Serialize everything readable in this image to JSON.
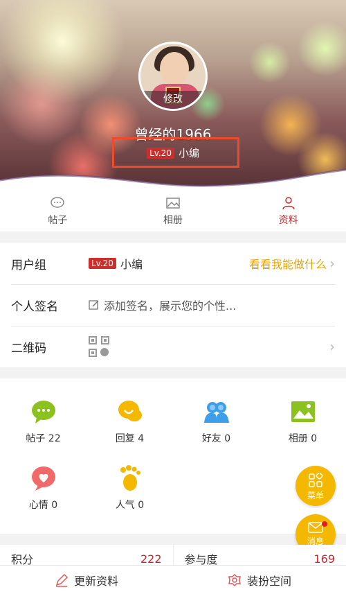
{
  "profile": {
    "username": "曾经的1966",
    "edit_label": "修改",
    "level_badge": "Lv.20",
    "level_title": "小编"
  },
  "tabs": [
    {
      "label": "帖子",
      "icon": "chat-bubble-icon",
      "active": false
    },
    {
      "label": "相册",
      "icon": "picture-icon",
      "active": false
    },
    {
      "label": "资料",
      "icon": "user-icon",
      "active": true
    }
  ],
  "info": {
    "user_group": {
      "label": "用户组",
      "badge": "Lv.20",
      "value": "小编",
      "action": "看看我能做什么"
    },
    "signature": {
      "label": "个人签名",
      "placeholder": "添加签名，展示您的个性..."
    },
    "qrcode": {
      "label": "二维码"
    }
  },
  "grid": [
    {
      "label": "帖子 22",
      "icon": "message-icon",
      "color": "#8cc21f"
    },
    {
      "label": "回复 4",
      "icon": "reply-icon",
      "color": "#f5b800"
    },
    {
      "label": "好友 0",
      "icon": "friends-icon",
      "color": "#3c9fe8"
    },
    {
      "label": "相册 0",
      "icon": "album-icon",
      "color": "#8cc21f"
    },
    {
      "label": "心情 0",
      "icon": "mood-heart-icon",
      "color": "#f06a6a"
    },
    {
      "label": "人气 0",
      "icon": "footprint-icon",
      "color": "#f5b800"
    }
  ],
  "fabs": {
    "menu_label": "菜单",
    "message_label": "消息"
  },
  "stats": [
    {
      "label": "积分",
      "value": "222"
    },
    {
      "label": "参与度",
      "value": "169"
    }
  ],
  "bottom": {
    "update_label": "更新资料",
    "decorate_label": "装扮空间"
  },
  "colors": {
    "accent": "#c8252c",
    "yellow": "#f5b800",
    "highlight": "#f04a2a"
  }
}
